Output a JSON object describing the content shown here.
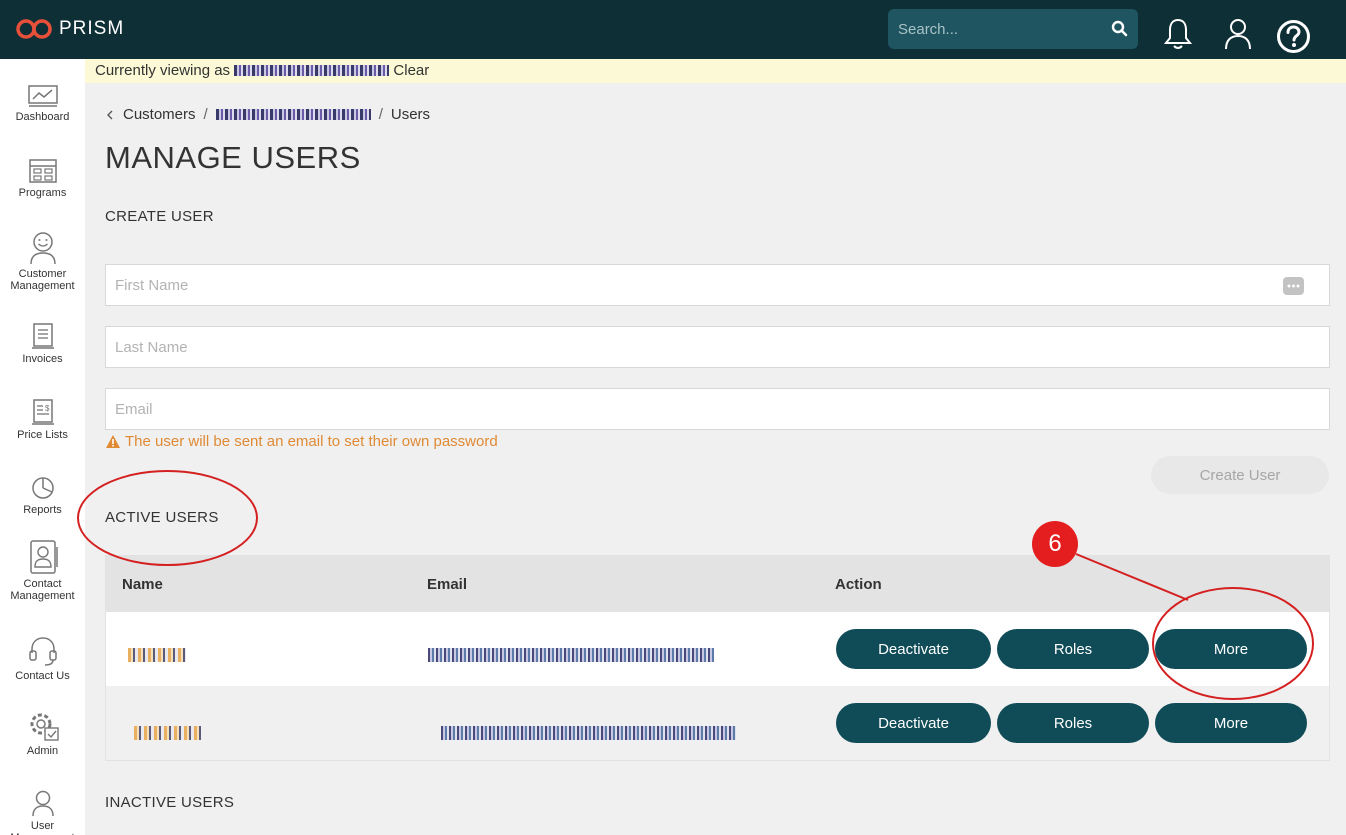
{
  "app": {
    "name": "PRISM"
  },
  "header": {
    "search_placeholder": "Search..."
  },
  "viewing": {
    "prefix": "Currently viewing as",
    "clear": "Clear"
  },
  "sidebar": {
    "items": [
      {
        "label": "Dashboard"
      },
      {
        "label": "Programs"
      },
      {
        "label": "Customer Management"
      },
      {
        "label": "Invoices"
      },
      {
        "label": "Price Lists"
      },
      {
        "label": "Reports"
      },
      {
        "label": "Contact Management"
      },
      {
        "label": "Contact Us"
      },
      {
        "label": "Admin"
      },
      {
        "label": "User Management"
      }
    ]
  },
  "breadcrumb": {
    "customers": "Customers",
    "users": "Users"
  },
  "page": {
    "title": "MANAGE USERS",
    "create_section": "CREATE USER",
    "first_name_placeholder": "First Name",
    "last_name_placeholder": "Last Name",
    "email_placeholder": "Email",
    "warning": "The user will be sent an email to set their own password",
    "create_button": "Create User",
    "active_section": "ACTIVE USERS",
    "inactive_section": "INACTIVE USERS"
  },
  "table": {
    "headers": {
      "name": "Name",
      "email": "Email",
      "action": "Action"
    },
    "actions": {
      "deactivate": "Deactivate",
      "roles": "Roles",
      "more": "More"
    }
  },
  "annotation": {
    "step": "6",
    "color": "#d42020"
  },
  "colors": {
    "header_bg": "#0f2f36",
    "accent": "#0f4c57",
    "warning": "#e08a34",
    "logo": "#e8503a"
  }
}
